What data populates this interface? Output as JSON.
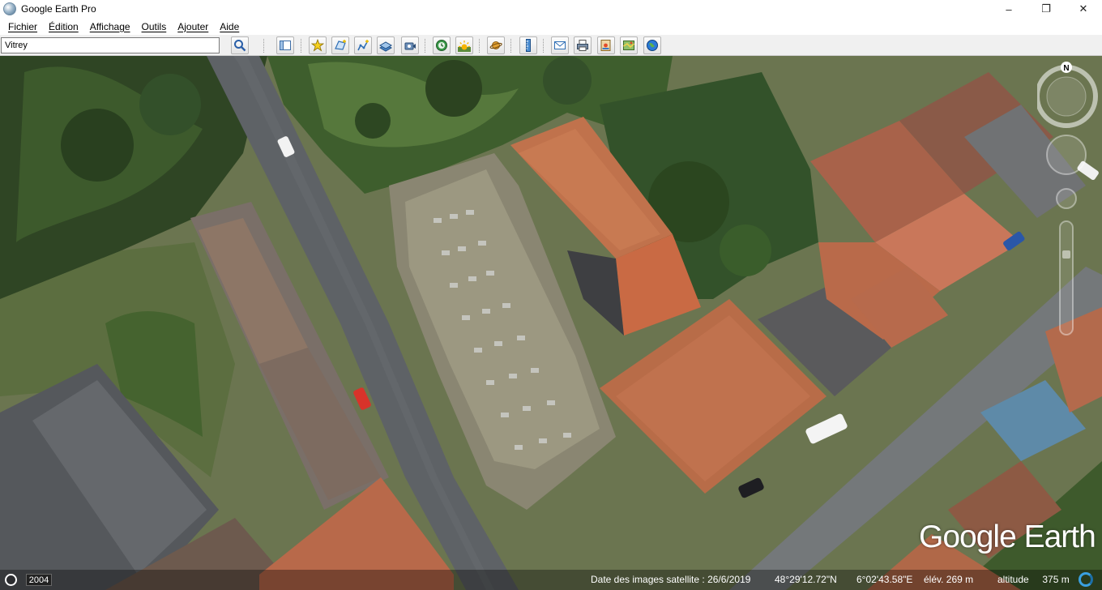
{
  "window": {
    "title": "Google Earth Pro",
    "minimize": "–",
    "maximize": "❐",
    "close": "✕"
  },
  "menu": [
    "Fichier",
    "Édition",
    "Affichage",
    "Outils",
    "Ajouter",
    "Aide"
  ],
  "search": {
    "value": "Vitrey",
    "search_button_icon": "search-icon"
  },
  "toolbar": {
    "buttons": [
      "sidebar-toggle-icon",
      "placemark-icon",
      "polygon-icon",
      "path-icon",
      "image-overlay-icon",
      "record-tour-icon",
      "historical-imagery-icon",
      "sunlight-icon",
      "planets-icon",
      "ruler-icon",
      "email-icon",
      "print-icon",
      "save-image-icon",
      "view-in-maps-icon",
      "earth-icon"
    ]
  },
  "navigation": {
    "north_label": "N"
  },
  "map": {
    "logo": "Google Earth",
    "year": "2004"
  },
  "status": {
    "imagery_date": "Date des images satellite : 26/6/2019",
    "latitude": "48°29'12.72\"N",
    "longitude": "6°02'43.58\"E",
    "elevation": "élév.   269 m",
    "altitude": "altitude     375 m"
  },
  "colors": {
    "roof_orange": "#c4714a",
    "roof_grey": "#6b6c6e",
    "road": "#5d6064",
    "vegetation": "#3e5a2e",
    "grass": "#6e8a4a"
  }
}
